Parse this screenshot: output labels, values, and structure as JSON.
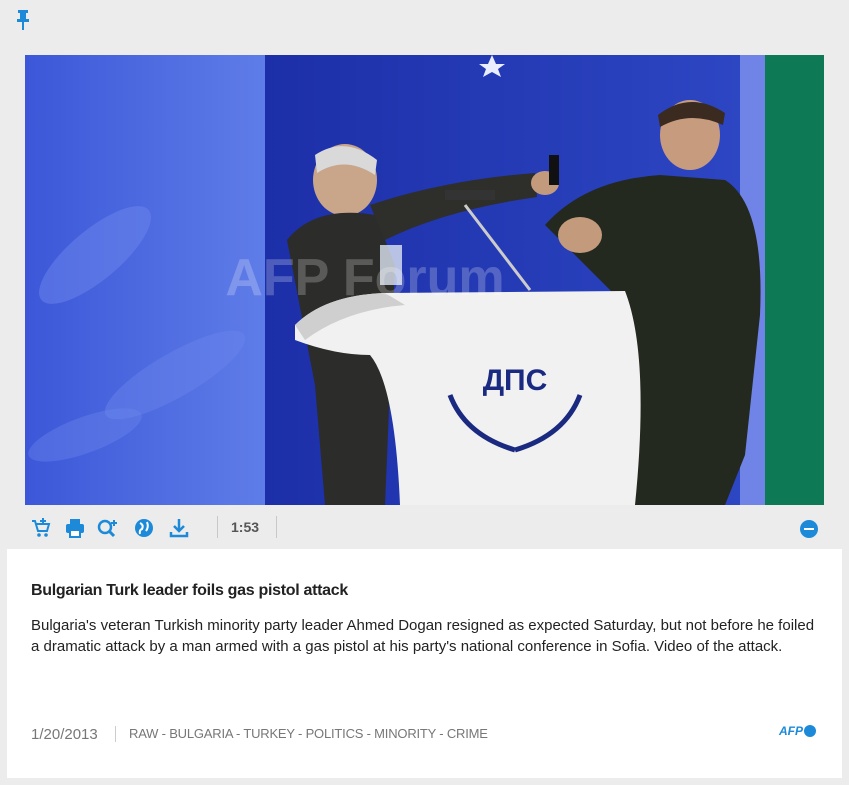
{
  "icons": {
    "pin": "pin-icon",
    "cart": "cart-icon",
    "print": "print-icon",
    "zoom": "zoom-icon",
    "share": "globe-icon",
    "download": "download-icon",
    "collapse": "minus-circle-icon"
  },
  "video": {
    "watermark": "AFP Forum",
    "podium_logo": "ДПС",
    "duration": "1:53"
  },
  "article": {
    "title": "Bulgarian Turk leader foils gas pistol attack",
    "description": "Bulgaria's veteran Turkish minority party leader Ahmed Dogan resigned as expected Saturday, but not before he foiled a dramatic attack by a man armed with a gas pistol at his party's national conference in Sofia. Video of the attack.",
    "date": "1/20/2013",
    "tags": "RAW - BULGARIA - TURKEY - POLITICS - MINORITY - CRIME",
    "source": "AFP"
  },
  "colors": {
    "accent": "#1c8ad8",
    "background": "#ececec"
  }
}
